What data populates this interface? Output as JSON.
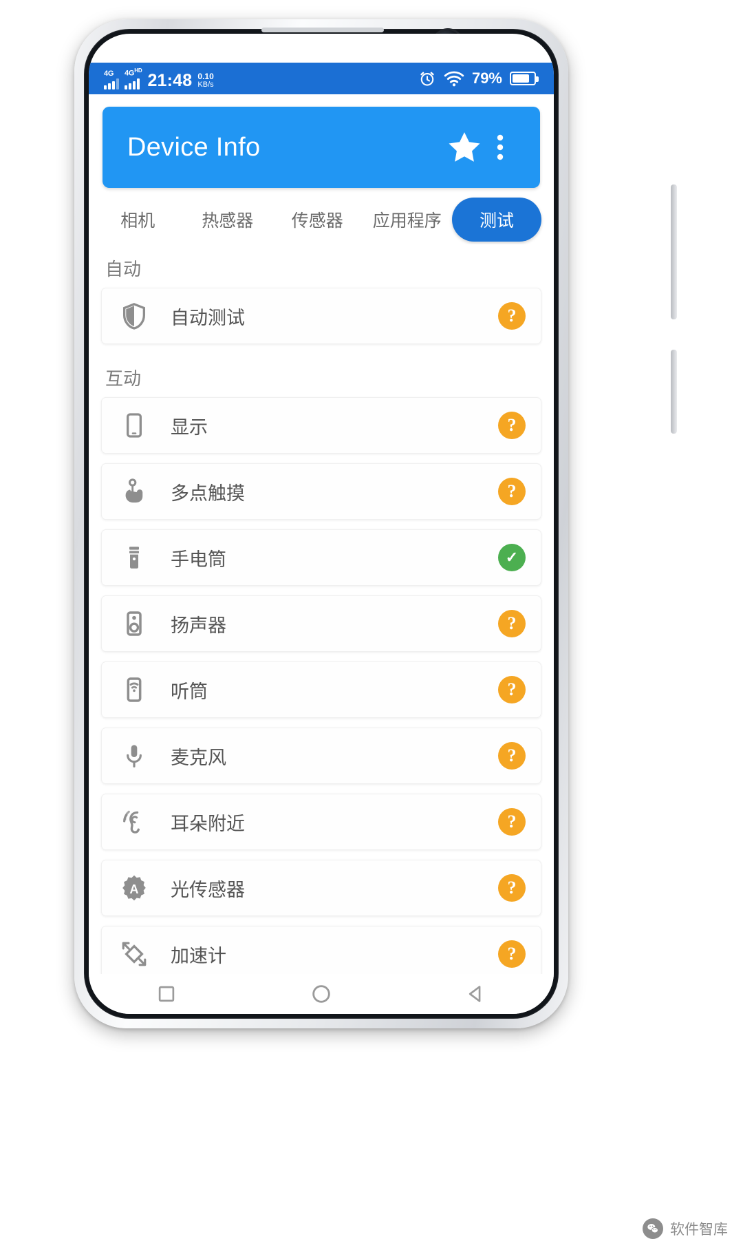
{
  "status_bar": {
    "network_tag_1": "4G",
    "network_tag_2": "4G",
    "network_tag_2_sup": "HD",
    "clock": "21:48",
    "net_speed_value": "0.10",
    "net_speed_unit": "KB/s",
    "battery_percent": "79%",
    "battery_level": 79,
    "icons": [
      "alarm-icon",
      "wifi-icon",
      "battery-icon"
    ]
  },
  "app_bar": {
    "title": "Device Info",
    "favorite_icon": "star-icon",
    "overflow_icon": "more-vertical-icon"
  },
  "tabs": [
    {
      "label": "相机",
      "active": false
    },
    {
      "label": "热感器",
      "active": false
    },
    {
      "label": "传感器",
      "active": false
    },
    {
      "label": "应用程序",
      "active": false
    },
    {
      "label": "测试",
      "active": true
    }
  ],
  "sections": [
    {
      "label": "自动",
      "items": [
        {
          "label": "自动测试",
          "icon": "shield-icon",
          "status": "unknown",
          "status_glyph": "?"
        }
      ]
    },
    {
      "label": "互动",
      "items": [
        {
          "label": "显示",
          "icon": "smartphone-icon",
          "status": "unknown",
          "status_glyph": "?"
        },
        {
          "label": "多点触摸",
          "icon": "touch-icon",
          "status": "unknown",
          "status_glyph": "?"
        },
        {
          "label": "手电筒",
          "icon": "flashlight-icon",
          "status": "pass",
          "status_glyph": "✓"
        },
        {
          "label": "扬声器",
          "icon": "speaker-icon",
          "status": "unknown",
          "status_glyph": "?"
        },
        {
          "label": "听筒",
          "icon": "earpiece-icon",
          "status": "unknown",
          "status_glyph": "?"
        },
        {
          "label": "麦克风",
          "icon": "microphone-icon",
          "status": "unknown",
          "status_glyph": "?"
        },
        {
          "label": "耳朵附近",
          "icon": "proximity-ear-icon",
          "status": "unknown",
          "status_glyph": "?"
        },
        {
          "label": "光传感器",
          "icon": "brightness-a-icon",
          "status": "unknown",
          "status_glyph": "?"
        },
        {
          "label": "加速计",
          "icon": "accelerometer-icon",
          "status": "unknown",
          "status_glyph": "?"
        }
      ]
    }
  ],
  "nav_bar": {
    "recents_label": "recents-square-icon",
    "home_label": "home-circle-icon",
    "back_label": "back-triangle-icon"
  },
  "watermark": {
    "text": "软件智库",
    "icon": "wechat-icon"
  },
  "colors": {
    "status_bar": "#1b6fd4",
    "app_bar": "#2196f3",
    "active_tab": "#1b74d6",
    "badge_unknown": "#f5a623",
    "badge_pass": "#4caf50"
  }
}
